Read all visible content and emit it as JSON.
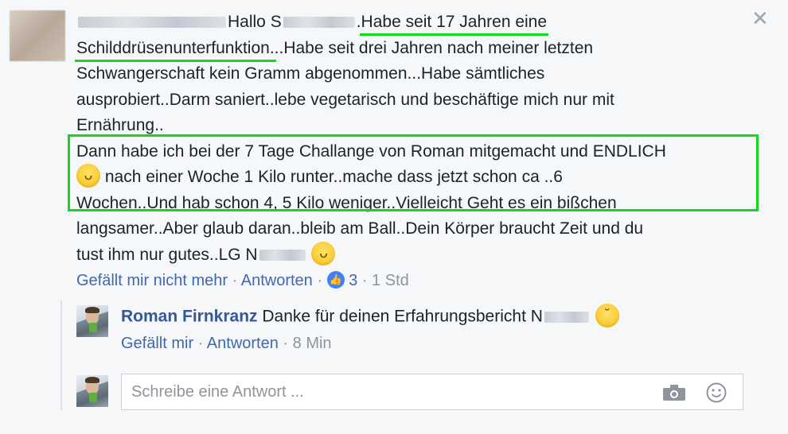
{
  "comment": {
    "close_symbol": "✕",
    "greeting": "Hallo S",
    "l1_sep": ".",
    "l1_underlined": "Habe seit 17 Jahren eine",
    "l2_underlined": "Schilddrüsenunterfunktion.",
    "l2_rest": "..Habe seit drei Jahren nach meiner letzten",
    "l3": "Schwangerschaft kein Gramm abgenommen...Habe sämtliches",
    "l4": "ausprobiert..Darm saniert..lebe vegetarisch und beschäftige mich nur mit",
    "l5": "Ernährung..",
    "l6": "Dann habe ich bei der 7 Tage Challange von Roman mitgemacht und ENDLICH",
    "l7": "nach einer Woche 1 Kilo runter..mache dass jetzt schon ca ..6",
    "l8": "Wochen..Und hab schon 4, 5 Kilo weniger..Vielleicht Geht es ein bißchen",
    "l9": "langsamer..Aber glaub daran..bleib am Ball..Dein Körper braucht Zeit und du",
    "l10": "tust ihm nur gutes..LG N",
    "emoji_grin": "laughing-emoji",
    "actions": {
      "unlike": "Gefällt mir nicht mehr",
      "sep1": " · ",
      "reply": "Antworten",
      "sep2": " · ",
      "like_count": "3",
      "sep3": " · ",
      "time": "1 Std"
    }
  },
  "reply": {
    "author": "Roman Firnkranz",
    "text": "Danke für deinen Erfahrungsbericht N",
    "emoji": "wink-emoji",
    "actions": {
      "like": "Gefällt mir",
      "sep1": " · ",
      "reply": "Antworten",
      "sep2": " · ",
      "time": "8 Min"
    }
  },
  "composer": {
    "placeholder": "Schreibe eine Antwort ..."
  },
  "colors": {
    "highlight": "#16d61b",
    "link": "#4267b2",
    "author": "#365899",
    "meta": "#90949c"
  }
}
